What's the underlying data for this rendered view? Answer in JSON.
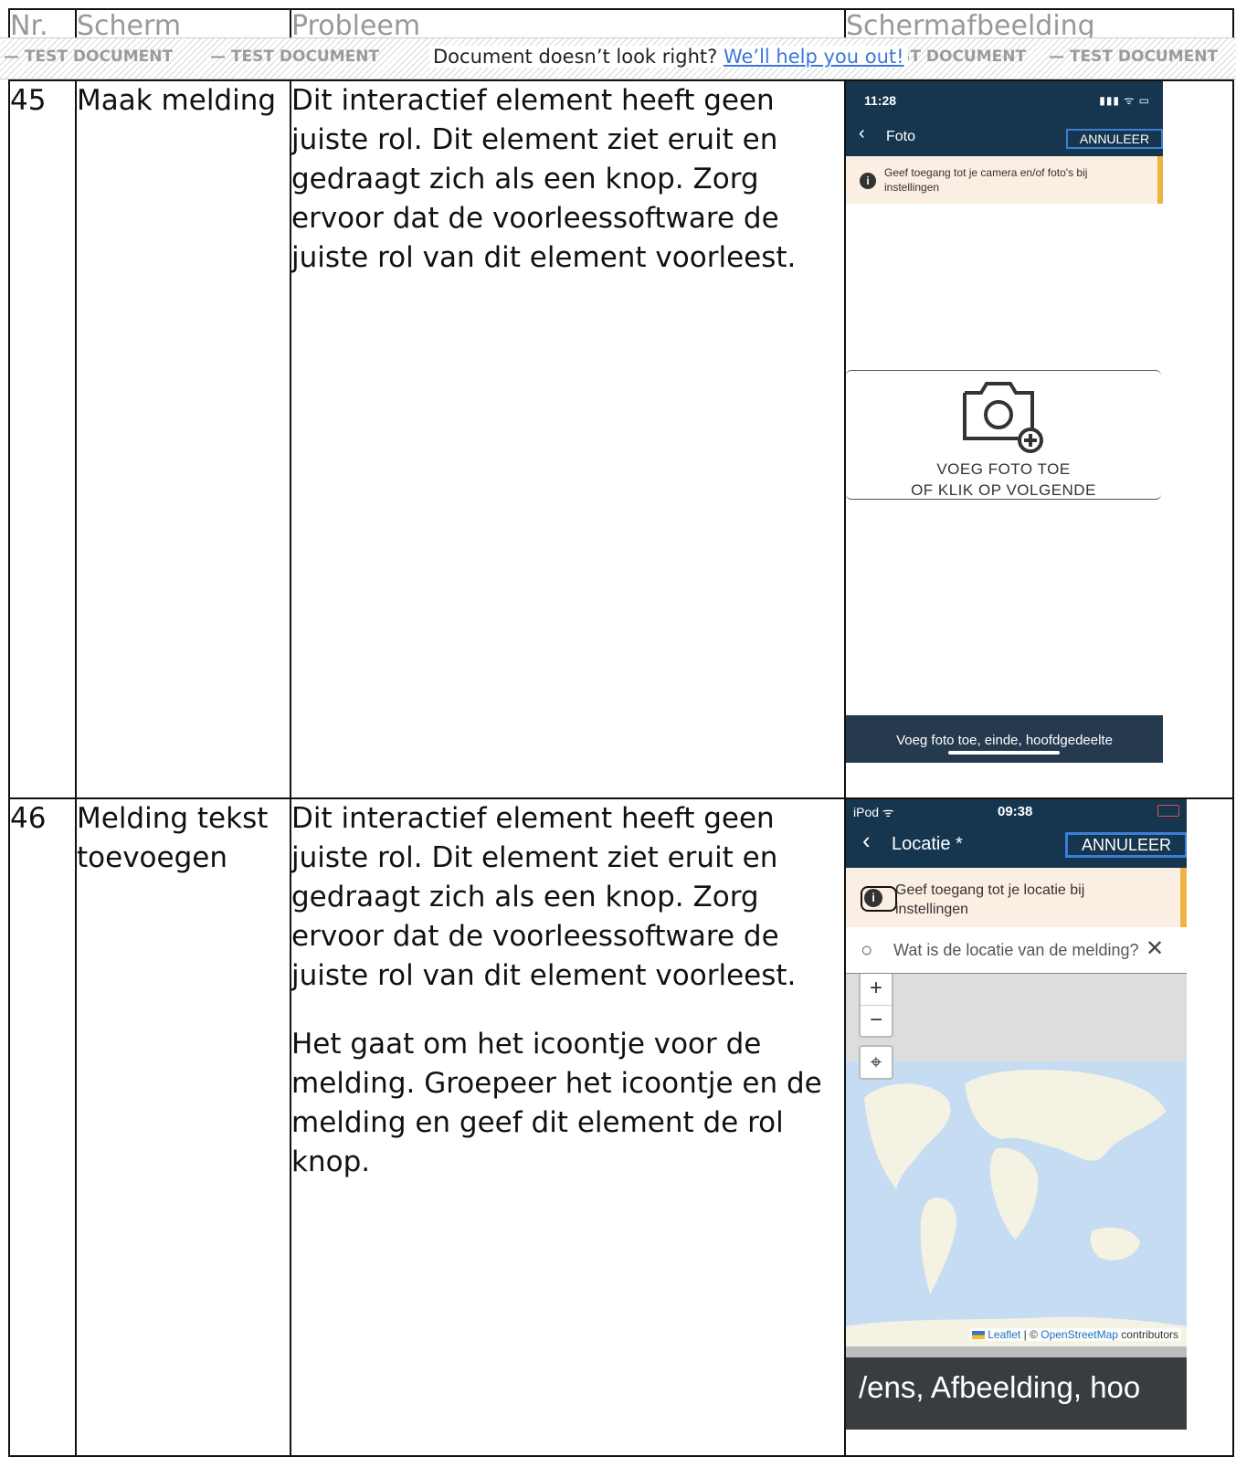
{
  "table": {
    "headers": [
      "Nr.",
      "Scherm",
      "Probleem",
      "Schermafbeelding"
    ],
    "rows": [
      {
        "nr": "45",
        "screen": "Maak melding",
        "problem": [
          "Dit interactief element heeft geen juiste rol. Dit element ziet eruit en gedraagt zich als een knop. Zorg ervoor dat de voorleessoftware de juiste rol van dit element voorleest."
        ],
        "screenshot": {
          "time": "11:28",
          "status_icons": "▮▮▮ ᯤ ▭",
          "back_icon": "chevron-left-icon",
          "title": "Foto",
          "cancel": "ANNULEER",
          "notice": "Geef toegang tot je camera en/of foto's bij instellingen",
          "add_label_1": "VOEG FOTO TOE",
          "add_label_2": "OF KLIK OP VOLGENDE",
          "voiceover": "Voeg foto toe, einde, hoofdgedeelte"
        }
      },
      {
        "nr": "46",
        "screen": "Melding tekst toevoegen",
        "problem": [
          "Dit interactief element heeft geen juiste rol. Dit element ziet eruit en gedraagt zich als een knop. Zorg ervoor dat de voorleessoftware de juiste rol van dit element voorleest.",
          "Het gaat om het icoontje voor de melding. Groepeer het icoontje en de melding en geef dit element de rol knop."
        ],
        "screenshot": {
          "device": "iPod",
          "time": "09:38",
          "title": "Locatie *",
          "cancel": "ANNULEER",
          "notice": "Geef toegang tot je locatie bij instellingen",
          "search_placeholder": "Wat is de locatie van de melding?",
          "zoom_in": "+",
          "zoom_out": "−",
          "attribution_leaflet": "Leaflet",
          "attribution_sep": " | © ",
          "attribution_osm": "OpenStreetMap",
          "attribution_tail": " contributors",
          "voiceover": "/ens, Afbeelding, hoo"
        }
      }
    ]
  },
  "watermark": {
    "label": "TEST DOCUMENT",
    "dash": "—",
    "help_text": "Document doesn’t look right?",
    "help_link": "We’ll help you out!"
  },
  "colors": {
    "app_header": "#163650",
    "notice_bg": "#fbeee2",
    "notice_accent": "#f0b341",
    "button_border": "#3b7fd6",
    "link": "#3a77d8"
  }
}
